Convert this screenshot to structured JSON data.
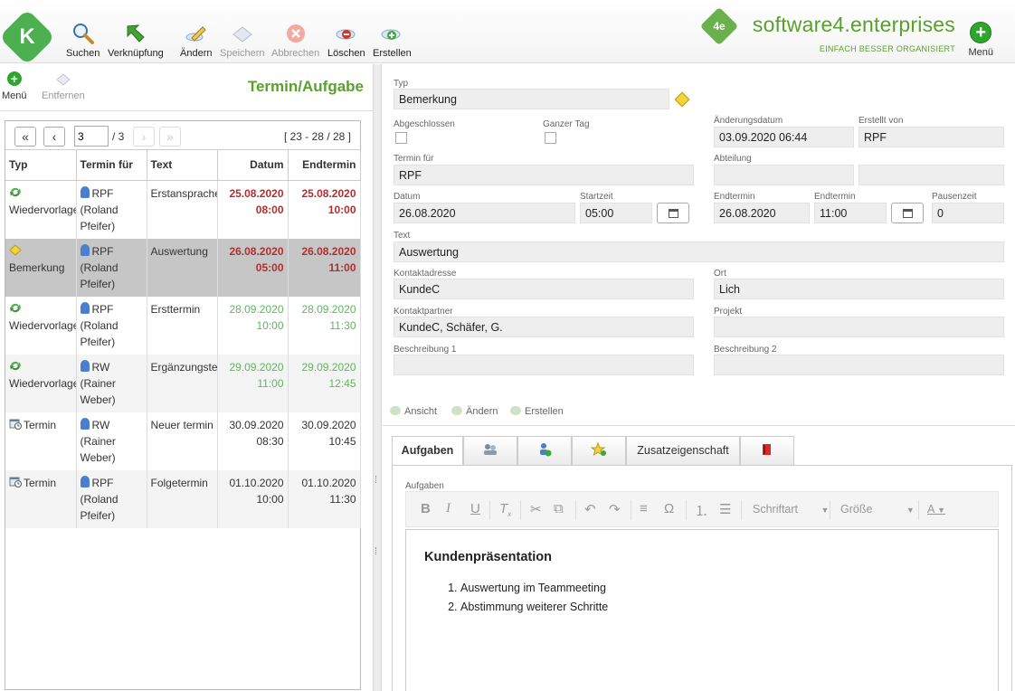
{
  "toolbar": {
    "app_logo": "K",
    "buttons": [
      {
        "label": "Suchen",
        "icon": "search-icon",
        "enabled": true
      },
      {
        "label": "Verknüpfung",
        "icon": "link-arrow-icon",
        "enabled": true
      },
      {
        "label": "Ändern",
        "icon": "edit-icon",
        "enabled": true
      },
      {
        "label": "Speichern",
        "icon": "save-icon",
        "enabled": false
      },
      {
        "label": "Abbrechen",
        "icon": "cancel-icon",
        "enabled": false
      },
      {
        "label": "Löschen",
        "icon": "delete-icon",
        "enabled": true
      },
      {
        "label": "Erstellen",
        "icon": "create-icon",
        "enabled": true
      }
    ],
    "brand_mark": "4e",
    "brand_name": "software4.enterprises",
    "brand_tagline": "EINFACH BESSER ORGANISIERT",
    "menu_label": "Menü"
  },
  "left": {
    "menu_label": "Menü",
    "remove_label": "Entfernen",
    "title": "Termin/Aufgabe",
    "pager": {
      "first": "«",
      "prev": "‹",
      "page": "3",
      "total": "/ 3",
      "next": "›",
      "last": "»",
      "range": "[ 23 - 28 / 28 ]"
    },
    "columns": [
      "Typ",
      "Termin für",
      "Text",
      "Datum",
      "Endtermin"
    ],
    "rows": [
      {
        "typ": "Wiedervorlage",
        "typ_icon": "recurring-icon",
        "who": "RPF",
        "who_full": "(Roland Pfeifer)",
        "text": "Erstansprache",
        "date": "25.08.2020",
        "time": "08:00",
        "end_date": "25.08.2020",
        "end_time": "10:00",
        "tone": "red"
      },
      {
        "typ": "Bemerkung",
        "typ_icon": "note-diamond-icon",
        "who": "RPF",
        "who_full": "(Roland Pfeifer)",
        "text": "Auswertung",
        "date": "26.08.2020",
        "time": "05:00",
        "end_date": "26.08.2020",
        "end_time": "11:00",
        "tone": "red"
      },
      {
        "typ": "Wiedervorlage",
        "typ_icon": "recurring-icon",
        "who": "RPF",
        "who_full": "(Roland Pfeifer)",
        "text": "Ersttermin",
        "date": "28.09.2020",
        "time": "10:00",
        "end_date": "28.09.2020",
        "end_time": "11:30",
        "tone": "green"
      },
      {
        "typ": "Wiedervorlage",
        "typ_icon": "recurring-icon",
        "who": "RW",
        "who_full": "(Rainer Weber)",
        "text": "Ergänzungstermin",
        "date": "29.09.2020",
        "time": "11:00",
        "end_date": "29.09.2020",
        "end_time": "12:45",
        "tone": "green"
      },
      {
        "typ": "Termin",
        "typ_icon": "calendar-clock-icon",
        "who": "RW",
        "who_full": "(Rainer Weber)",
        "text": "Neuer termin",
        "date": "30.09.2020",
        "time": "08:30",
        "end_date": "30.09.2020",
        "end_time": "10:45",
        "tone": "normal"
      },
      {
        "typ": "Termin",
        "typ_icon": "calendar-clock-icon",
        "who": "RPF",
        "who_full": "(Roland Pfeifer)",
        "text": "Folgetermin",
        "date": "01.10.2020",
        "time": "10:00",
        "end_date": "01.10.2020",
        "end_time": "11:30",
        "tone": "normal"
      }
    ]
  },
  "form": {
    "typ_label": "Typ",
    "typ_value": "Bemerkung",
    "abgeschlossen_label": "Abgeschlossen",
    "ganzer_tag_label": "Ganzer Tag",
    "aenderungsdatum_label": "Änderungsdatum",
    "aenderungsdatum_value": "03.09.2020 06:44",
    "erstellt_von_label": "Erstellt von",
    "erstellt_von_value": "RPF",
    "termin_fuer_label": "Termin für",
    "termin_fuer_value": "RPF",
    "abteilung_label": "Abteilung",
    "abteilung_value": "",
    "abteilung_value2": "",
    "datum_label": "Datum",
    "datum_value": "26.08.2020",
    "startzeit_label": "Startzeit",
    "startzeit_value": "05:00",
    "endtermin_label": "Endtermin",
    "endtermin_value": "26.08.2020",
    "endtermin_time_label": "Endtermin",
    "endtermin_time_value": "11:00",
    "pausenzeit_label": "Pausenzeit",
    "pausenzeit_value": "0",
    "text_label": "Text",
    "text_value": "Auswertung",
    "kontaktadresse_label": "Kontaktadresse",
    "kontaktadresse_value": "KundeC",
    "ort_label": "Ort",
    "ort_value": "Lich",
    "kontaktpartner_label": "Kontaktpartner",
    "kontaktpartner_value": "KundeC, Schäfer, G.",
    "projekt_label": "Projekt",
    "projekt_value": "",
    "beschreibung1_label": "Beschreibung 1",
    "beschreibung1_value": "",
    "beschreibung2_label": "Beschreibung 2",
    "beschreibung2_value": ""
  },
  "actions": {
    "view": "Ansicht",
    "edit": "Ändern",
    "create": "Erstellen"
  },
  "tabs": [
    {
      "label": "Aufgaben",
      "icon": "",
      "active": true
    },
    {
      "label": "",
      "icon": "people-icon",
      "active": false
    },
    {
      "label": "",
      "icon": "user-add-icon",
      "active": false
    },
    {
      "label": "",
      "icon": "star-icon",
      "active": false
    },
    {
      "label": "Zusatzeigenschaft",
      "icon": "",
      "active": false
    },
    {
      "label": "",
      "icon": "book-icon",
      "active": false
    }
  ],
  "editor": {
    "field_label": "Aufgaben",
    "font_placeholder": "Schriftart",
    "size_placeholder": "Größe",
    "heading": "Kundenpräsentation",
    "items": [
      "Auswertung im Teammeeting",
      "Abstimmung weiterer Schritte"
    ]
  },
  "colors": {
    "brand_green": "#5aa02c",
    "overdue_red": "#b03030",
    "future_green": "#5cb85c",
    "selected_row": "#c6c6c6"
  }
}
